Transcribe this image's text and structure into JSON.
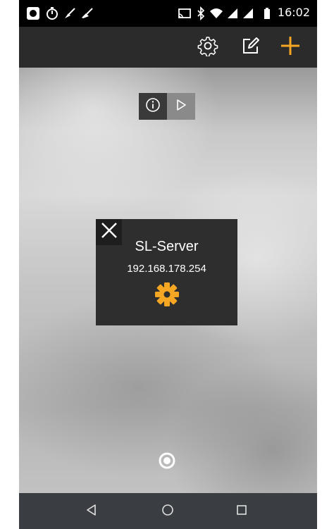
{
  "status_bar": {
    "time": "16:02",
    "left_icons": [
      "app-notification-icon",
      "timer-icon",
      "broom-icon",
      "broom-icon"
    ],
    "right_icons": [
      "cast-icon",
      "bluetooth-icon",
      "wifi-icon",
      "signal-icon",
      "signal-icon",
      "battery-icon"
    ]
  },
  "toolbar": {
    "icons": [
      "gear-icon",
      "edit-icon",
      "plus-icon"
    ],
    "accent_color": "#f5a623"
  },
  "mode_toggle": {
    "icons": [
      "info-icon",
      "play-icon"
    ],
    "selected": "info"
  },
  "server_card": {
    "name": "SL-Server",
    "ip": "192.168.178.254",
    "gear_color": "#f5a623"
  },
  "page_indicator": {
    "pages": 1,
    "current": 1
  },
  "nav_bar": {
    "icons": [
      "back-icon",
      "home-icon",
      "recents-icon"
    ]
  }
}
